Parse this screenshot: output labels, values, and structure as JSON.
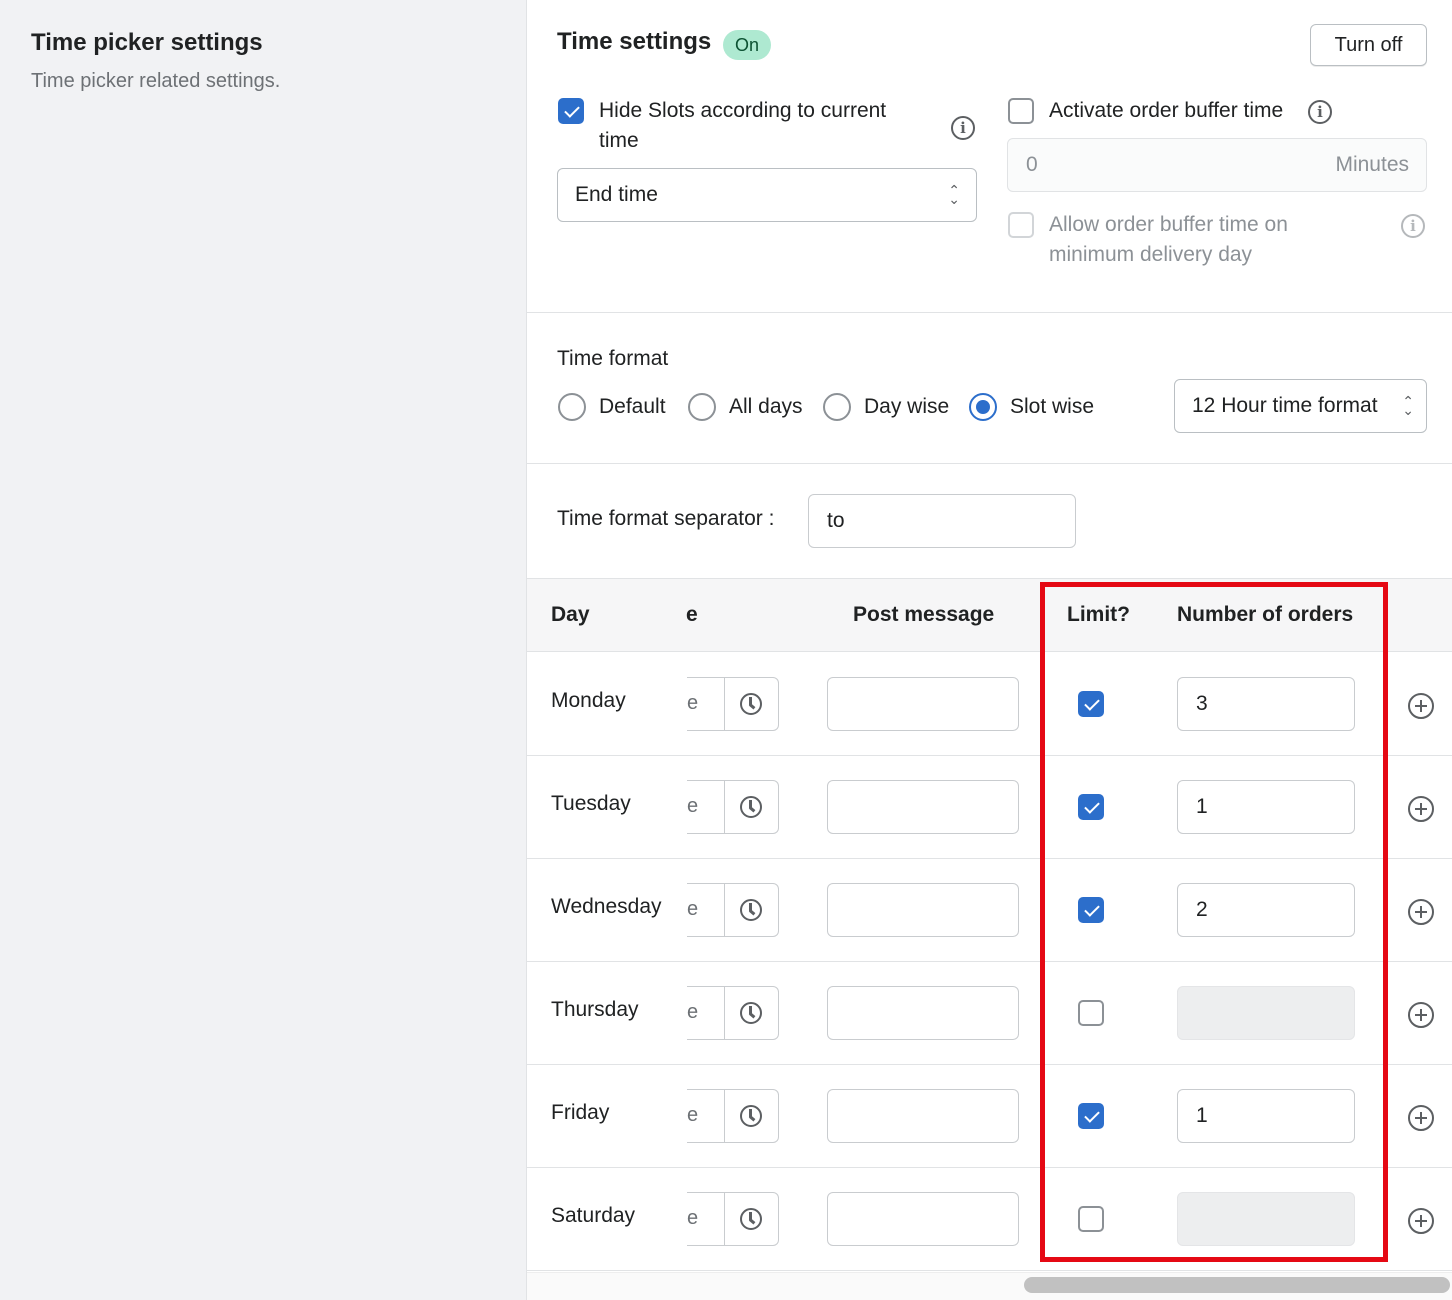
{
  "sidebar": {
    "title": "Time picker settings",
    "description": "Time picker related settings."
  },
  "time_settings": {
    "title": "Time settings",
    "status_badge": "On",
    "turn_off_label": "Turn off",
    "hide_slots": {
      "label": "Hide Slots according to current time",
      "checked": true
    },
    "hide_slots_select": {
      "value": "End time"
    },
    "buffer_time": {
      "label": "Activate order buffer time",
      "checked": false,
      "value": "0",
      "suffix": "Minutes"
    },
    "buffer_min_day": {
      "label": "Allow order buffer time on minimum delivery day",
      "checked": false
    }
  },
  "time_format": {
    "label": "Time format",
    "options": [
      "Default",
      "All days",
      "Day wise",
      "Slot wise"
    ],
    "selected": "Slot wise",
    "format_select": "12 Hour time format",
    "separator_label": "Time format separator :",
    "separator_value": "to"
  },
  "table": {
    "headers": {
      "day": "Day",
      "time": "e",
      "post_message": "Post message",
      "limit": "Limit?",
      "orders": "Number of orders"
    },
    "rows": [
      {
        "day": "Monday",
        "time": "e",
        "limit": true,
        "orders": "3"
      },
      {
        "day": "Tuesday",
        "time": "e",
        "limit": true,
        "orders": "1"
      },
      {
        "day": "Wednesday",
        "time": "e",
        "limit": true,
        "orders": "2"
      },
      {
        "day": "Thursday",
        "time": "e",
        "limit": false,
        "orders": ""
      },
      {
        "day": "Friday",
        "time": "e",
        "limit": true,
        "orders": "1"
      },
      {
        "day": "Saturday",
        "time": "e",
        "limit": false,
        "orders": ""
      }
    ]
  },
  "colors": {
    "accent": "#2c6ecb",
    "badge_bg": "#aee9d1",
    "highlight": "#e50914"
  },
  "icons": [
    "info-icon",
    "chevron-updown-icon",
    "clock-icon",
    "plus-circle-icon",
    "check-icon"
  ]
}
